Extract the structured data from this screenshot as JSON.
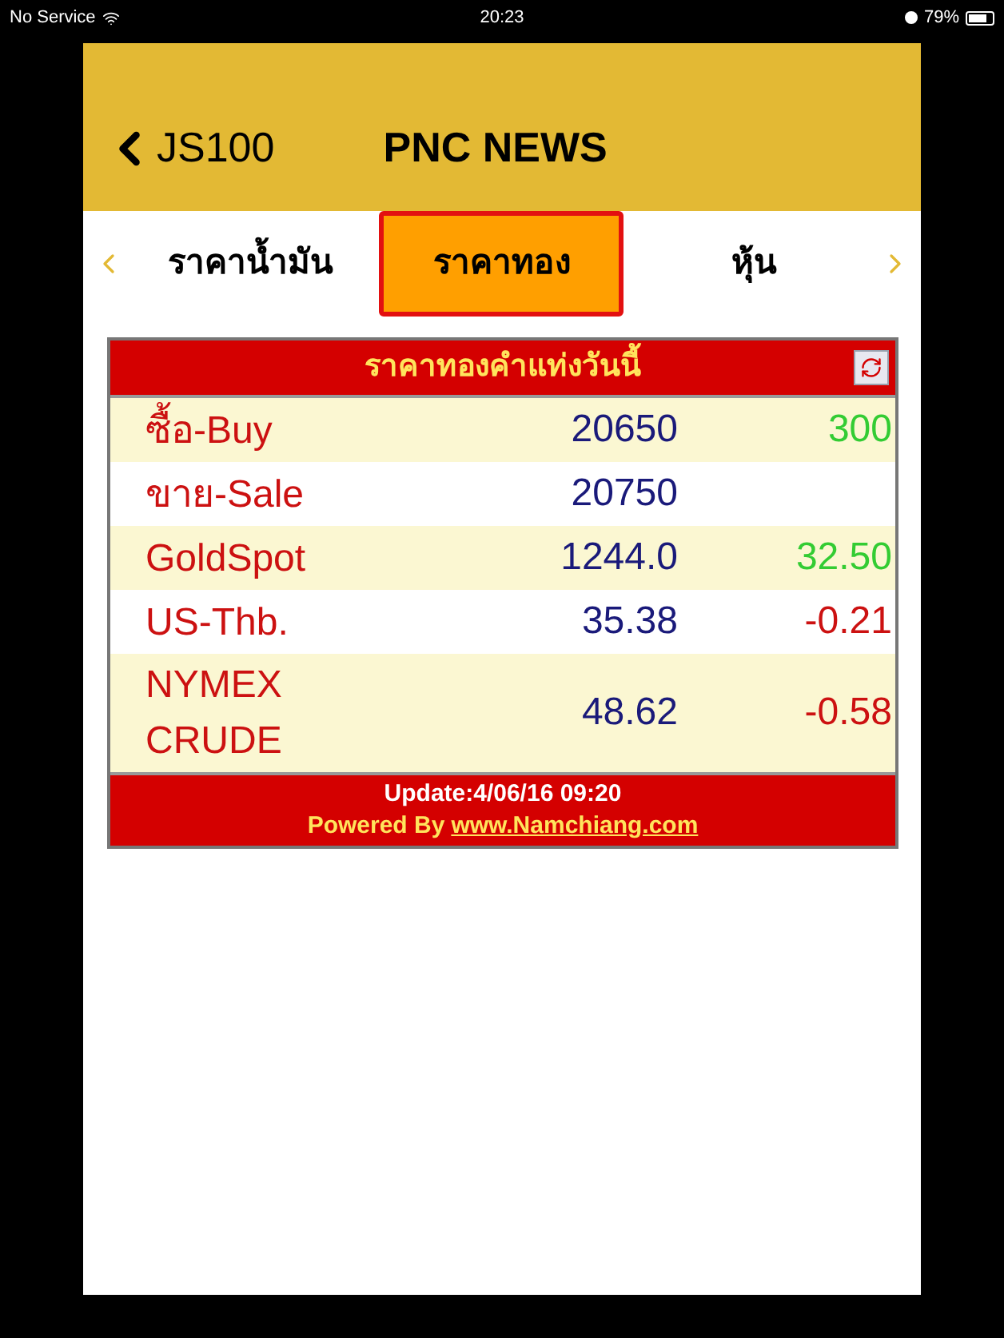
{
  "status_bar": {
    "carrier": "No Service",
    "time": "20:23",
    "battery": "79%"
  },
  "header": {
    "back_label": "JS100",
    "title": "PNC NEWS"
  },
  "tabs": [
    {
      "label": "ราคาน้ำมัน",
      "selected": false
    },
    {
      "label": "ราคาทอง",
      "selected": true
    },
    {
      "label": "หุ้น",
      "selected": false
    }
  ],
  "gold_table": {
    "title": "ราคาทองคำแท่งวันนี้",
    "rows": [
      {
        "label": "ซื้อ-Buy",
        "value": "20650",
        "change": {
          "text": "300",
          "color": "#33cc33"
        }
      },
      {
        "label": "ขาย-Sale",
        "value": "20750"
      },
      {
        "label": "GoldSpot",
        "value": "1244.0",
        "change": {
          "text": "32.50",
          "color": "#33cc33"
        }
      },
      {
        "label": "US-Thb.",
        "value": "35.38",
        "change": {
          "text": "-0.21",
          "color": "#cc1111"
        }
      },
      {
        "label": "NYMEX CRUDE",
        "value": "48.62",
        "change": {
          "text": "-0.58",
          "color": "#cc1111"
        }
      }
    ],
    "update": "Update:4/06/16 09:20",
    "powered_by": "Powered By",
    "link": "www.Namchiang.com"
  }
}
